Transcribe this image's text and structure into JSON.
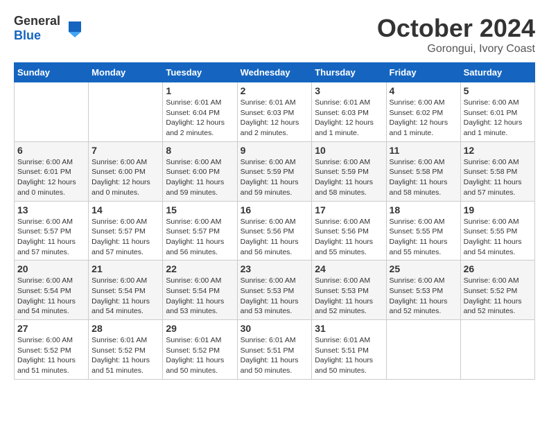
{
  "header": {
    "logo_general": "General",
    "logo_blue": "Blue",
    "month_title": "October 2024",
    "location": "Gorongui, Ivory Coast"
  },
  "days_of_week": [
    "Sunday",
    "Monday",
    "Tuesday",
    "Wednesday",
    "Thursday",
    "Friday",
    "Saturday"
  ],
  "weeks": [
    [
      {
        "day": "",
        "info": ""
      },
      {
        "day": "",
        "info": ""
      },
      {
        "day": "1",
        "info": "Sunrise: 6:01 AM\nSunset: 6:04 PM\nDaylight: 12 hours and 2 minutes."
      },
      {
        "day": "2",
        "info": "Sunrise: 6:01 AM\nSunset: 6:03 PM\nDaylight: 12 hours and 2 minutes."
      },
      {
        "day": "3",
        "info": "Sunrise: 6:01 AM\nSunset: 6:03 PM\nDaylight: 12 hours and 1 minute."
      },
      {
        "day": "4",
        "info": "Sunrise: 6:00 AM\nSunset: 6:02 PM\nDaylight: 12 hours and 1 minute."
      },
      {
        "day": "5",
        "info": "Sunrise: 6:00 AM\nSunset: 6:01 PM\nDaylight: 12 hours and 1 minute."
      }
    ],
    [
      {
        "day": "6",
        "info": "Sunrise: 6:00 AM\nSunset: 6:01 PM\nDaylight: 12 hours and 0 minutes."
      },
      {
        "day": "7",
        "info": "Sunrise: 6:00 AM\nSunset: 6:00 PM\nDaylight: 12 hours and 0 minutes."
      },
      {
        "day": "8",
        "info": "Sunrise: 6:00 AM\nSunset: 6:00 PM\nDaylight: 11 hours and 59 minutes."
      },
      {
        "day": "9",
        "info": "Sunrise: 6:00 AM\nSunset: 5:59 PM\nDaylight: 11 hours and 59 minutes."
      },
      {
        "day": "10",
        "info": "Sunrise: 6:00 AM\nSunset: 5:59 PM\nDaylight: 11 hours and 58 minutes."
      },
      {
        "day": "11",
        "info": "Sunrise: 6:00 AM\nSunset: 5:58 PM\nDaylight: 11 hours and 58 minutes."
      },
      {
        "day": "12",
        "info": "Sunrise: 6:00 AM\nSunset: 5:58 PM\nDaylight: 11 hours and 57 minutes."
      }
    ],
    [
      {
        "day": "13",
        "info": "Sunrise: 6:00 AM\nSunset: 5:57 PM\nDaylight: 11 hours and 57 minutes."
      },
      {
        "day": "14",
        "info": "Sunrise: 6:00 AM\nSunset: 5:57 PM\nDaylight: 11 hours and 57 minutes."
      },
      {
        "day": "15",
        "info": "Sunrise: 6:00 AM\nSunset: 5:57 PM\nDaylight: 11 hours and 56 minutes."
      },
      {
        "day": "16",
        "info": "Sunrise: 6:00 AM\nSunset: 5:56 PM\nDaylight: 11 hours and 56 minutes."
      },
      {
        "day": "17",
        "info": "Sunrise: 6:00 AM\nSunset: 5:56 PM\nDaylight: 11 hours and 55 minutes."
      },
      {
        "day": "18",
        "info": "Sunrise: 6:00 AM\nSunset: 5:55 PM\nDaylight: 11 hours and 55 minutes."
      },
      {
        "day": "19",
        "info": "Sunrise: 6:00 AM\nSunset: 5:55 PM\nDaylight: 11 hours and 54 minutes."
      }
    ],
    [
      {
        "day": "20",
        "info": "Sunrise: 6:00 AM\nSunset: 5:54 PM\nDaylight: 11 hours and 54 minutes."
      },
      {
        "day": "21",
        "info": "Sunrise: 6:00 AM\nSunset: 5:54 PM\nDaylight: 11 hours and 54 minutes."
      },
      {
        "day": "22",
        "info": "Sunrise: 6:00 AM\nSunset: 5:54 PM\nDaylight: 11 hours and 53 minutes."
      },
      {
        "day": "23",
        "info": "Sunrise: 6:00 AM\nSunset: 5:53 PM\nDaylight: 11 hours and 53 minutes."
      },
      {
        "day": "24",
        "info": "Sunrise: 6:00 AM\nSunset: 5:53 PM\nDaylight: 11 hours and 52 minutes."
      },
      {
        "day": "25",
        "info": "Sunrise: 6:00 AM\nSunset: 5:53 PM\nDaylight: 11 hours and 52 minutes."
      },
      {
        "day": "26",
        "info": "Sunrise: 6:00 AM\nSunset: 5:52 PM\nDaylight: 11 hours and 52 minutes."
      }
    ],
    [
      {
        "day": "27",
        "info": "Sunrise: 6:00 AM\nSunset: 5:52 PM\nDaylight: 11 hours and 51 minutes."
      },
      {
        "day": "28",
        "info": "Sunrise: 6:01 AM\nSunset: 5:52 PM\nDaylight: 11 hours and 51 minutes."
      },
      {
        "day": "29",
        "info": "Sunrise: 6:01 AM\nSunset: 5:52 PM\nDaylight: 11 hours and 50 minutes."
      },
      {
        "day": "30",
        "info": "Sunrise: 6:01 AM\nSunset: 5:51 PM\nDaylight: 11 hours and 50 minutes."
      },
      {
        "day": "31",
        "info": "Sunrise: 6:01 AM\nSunset: 5:51 PM\nDaylight: 11 hours and 50 minutes."
      },
      {
        "day": "",
        "info": ""
      },
      {
        "day": "",
        "info": ""
      }
    ]
  ]
}
